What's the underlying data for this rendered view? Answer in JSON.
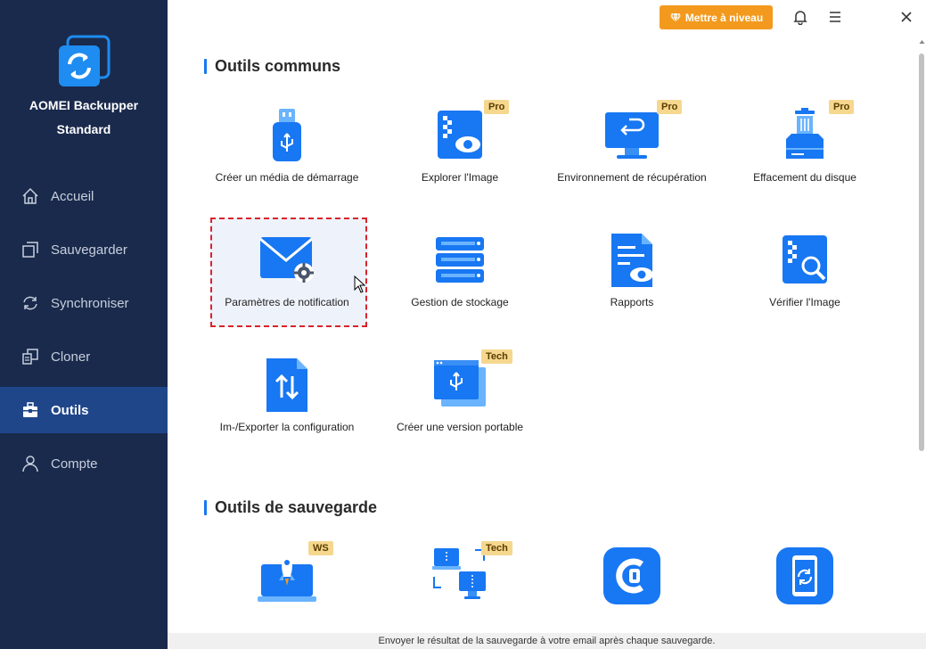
{
  "app": {
    "name": "AOMEI Backupper",
    "edition": "Standard"
  },
  "topbar": {
    "upgrade_label": "Mettre à niveau"
  },
  "sidebar": {
    "items": [
      {
        "label": "Accueil",
        "icon": "home-icon"
      },
      {
        "label": "Sauvegarder",
        "icon": "backup-icon"
      },
      {
        "label": "Synchroniser",
        "icon": "sync-icon"
      },
      {
        "label": "Cloner",
        "icon": "clone-icon"
      },
      {
        "label": "Outils",
        "icon": "toolbox-icon",
        "active": true
      },
      {
        "label": "Compte",
        "icon": "user-icon"
      }
    ]
  },
  "sections": {
    "common": {
      "title": "Outils communs",
      "tools": [
        {
          "label": "Créer un média de démarrage",
          "icon": "usb-drive-icon"
        },
        {
          "label": "Explorer l'Image",
          "icon": "explore-image-icon",
          "badge": "Pro"
        },
        {
          "label": "Environnement de récupération",
          "icon": "recovery-monitor-icon",
          "badge": "Pro"
        },
        {
          "label": "Effacement du disque",
          "icon": "disk-wipe-icon",
          "badge": "Pro"
        },
        {
          "label": "Paramètres de notification",
          "icon": "mail-settings-icon",
          "selected": true
        },
        {
          "label": "Gestion de stockage",
          "icon": "storage-server-icon"
        },
        {
          "label": "Rapports",
          "icon": "report-icon"
        },
        {
          "label": "Vérifier l'Image",
          "icon": "verify-image-icon"
        },
        {
          "label": "Im-/Exporter la configuration",
          "icon": "import-export-icon"
        },
        {
          "label": "Créer une version portable",
          "icon": "portable-version-icon",
          "badge": "Tech"
        }
      ]
    },
    "backup": {
      "title": "Outils de sauvegarde",
      "tools": [
        {
          "icon": "laptop-rocket-icon",
          "badge": "WS"
        },
        {
          "icon": "network-devices-icon",
          "badge": "Tech"
        },
        {
          "icon": "cbackup-icon"
        },
        {
          "icon": "phone-sync-icon"
        }
      ]
    }
  },
  "status_bar": {
    "text": "Envoyer le résultat de la sauvegarde à votre email après chaque sauvegarde."
  },
  "colors": {
    "sidebar_bg": "#1a2a4c",
    "sidebar_active": "#20468a",
    "accent": "#1877f2",
    "upgrade": "#f39a1e",
    "badge": "#f5d78e",
    "selection": "#d9232d"
  }
}
